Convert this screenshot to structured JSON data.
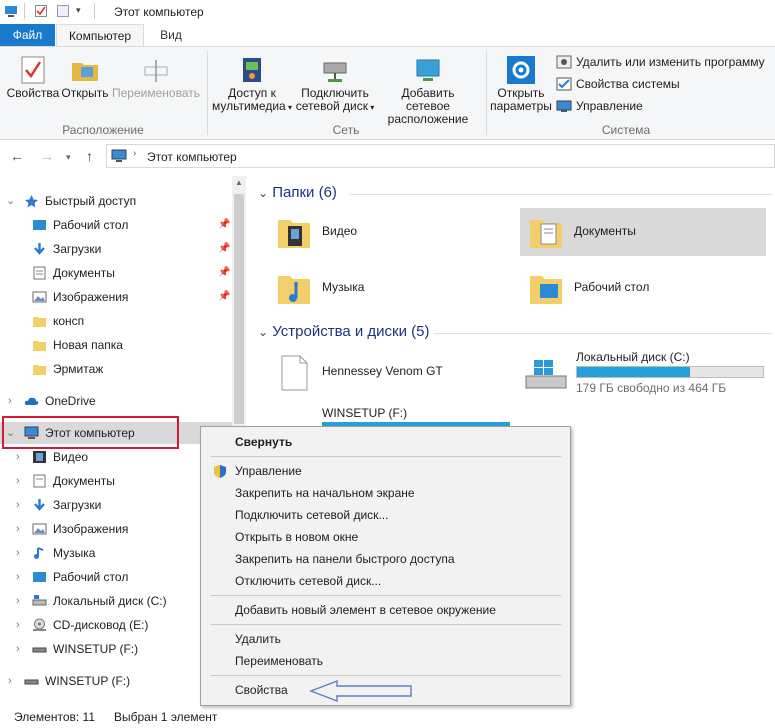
{
  "window": {
    "title": "Этот компьютер"
  },
  "ribbon": {
    "tabs": {
      "file": "Файл",
      "computer": "Компьютер",
      "view": "Вид"
    },
    "location": {
      "label": "Расположение",
      "properties": "Свойства",
      "open": "Открыть",
      "rename": "Переименовать"
    },
    "network": {
      "label": "Сеть",
      "media_line1": "Доступ к",
      "media_line2": "мультимедиа",
      "map_line1": "Подключить",
      "map_line2": "сетевой диск",
      "add_line1": "Добавить сетевое",
      "add_line2": "расположение"
    },
    "system": {
      "label": "Система",
      "open_line1": "Открыть",
      "open_line2": "параметры",
      "uninstall": "Удалить или изменить программу",
      "sys_props": "Свойства системы",
      "manage": "Управление"
    }
  },
  "address": {
    "path": "Этот компьютер"
  },
  "navpane": {
    "quick_access": "Быстрый доступ",
    "quick_items": [
      "Рабочий стол",
      "Загрузки",
      "Документы",
      "Изображения",
      "консп",
      "Новая папка",
      "Эрмитаж"
    ],
    "onedrive": "OneDrive",
    "this_pc": "Этот компьютер",
    "pc_items": [
      "Видео",
      "Документы",
      "Загрузки",
      "Изображения",
      "Музыка",
      "Рабочий стол",
      "Локальный диск (C:)",
      "CD-дисковод (E:)",
      "WINSETUP (F:)"
    ],
    "winsetup": "WINSETUP (F:)"
  },
  "content": {
    "folders_header": "Папки (6)",
    "folders": [
      "Видео",
      "Документы",
      "Музыка",
      "Рабочий стол"
    ],
    "devices_header": "Устройства и диски (5)",
    "device_hennessey": "Hennessey Venom GT",
    "device_local": "Локальный диск (C:)",
    "device_local_free": "179 ГБ свободно из 464 ГБ",
    "device_local_used_fraction": 0.61,
    "device_winsetup": "WINSETUP (F:)"
  },
  "context_menu": {
    "collapse": "Свернуть",
    "manage": "Управление",
    "pin_start": "Закрепить на начальном экране",
    "map_drive": "Подключить сетевой диск...",
    "open_new": "Открыть в новом окне",
    "pin_quick": "Закрепить на панели быстрого доступа",
    "disconnect": "Отключить сетевой диск...",
    "add_network": "Добавить новый элемент в сетевое окружение",
    "delete": "Удалить",
    "rename": "Переименовать",
    "properties": "Свойства"
  },
  "status": {
    "count": "Элементов: 11",
    "selected": "Выбран 1 элемент"
  },
  "colors": {
    "accent": "#1979ca",
    "highlight_box": "#d11a3a",
    "arrow": "#5b7fc4",
    "section_header": "#1e3287"
  }
}
